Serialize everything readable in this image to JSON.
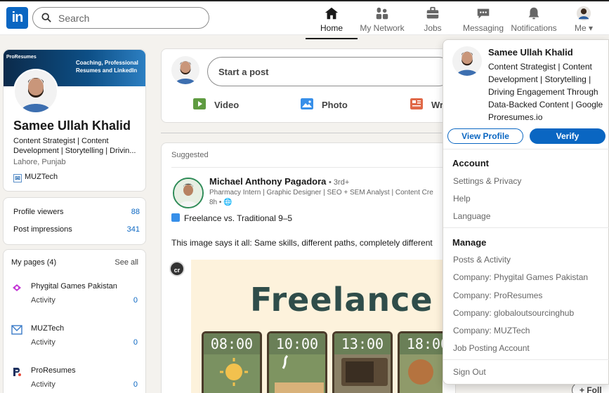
{
  "topbar": {
    "logo": "in",
    "search_placeholder": "Search",
    "nav": [
      {
        "label": "Home",
        "icon": "home-icon",
        "active": true
      },
      {
        "label": "My Network",
        "icon": "network-icon",
        "active": false
      },
      {
        "label": "Jobs",
        "icon": "briefcase-icon",
        "active": false
      },
      {
        "label": "Messaging",
        "icon": "messaging-icon",
        "active": false
      },
      {
        "label": "Notifications",
        "icon": "bell-icon",
        "active": false
      },
      {
        "label": "Me",
        "icon": "avatar-icon",
        "active": false
      }
    ]
  },
  "profile": {
    "banner_small": "ProResumes",
    "banner_text": "Coaching, Professional Resumes and LinkedIn",
    "name": "Samee Ullah Khalid",
    "headline": "Content Strategist | Content Development | Storytelling | Drivin...",
    "location": "Lahore, Punjab",
    "org": "MUZTech"
  },
  "stats": [
    {
      "label": "Profile viewers",
      "value": "88"
    },
    {
      "label": "Post impressions",
      "value": "341"
    }
  ],
  "mypages": {
    "title": "My pages (4)",
    "see_all": "See all",
    "items": [
      {
        "name": "Phygital Games Pakistan",
        "activity": "Activity",
        "count": "0"
      },
      {
        "name": "MUZTech",
        "activity": "Activity",
        "count": "0"
      },
      {
        "name": "ProResumes",
        "activity": "Activity",
        "count": "0"
      }
    ]
  },
  "share": {
    "placeholder": "Start a post",
    "actions": [
      {
        "label": "Video",
        "color": "#5f9b41"
      },
      {
        "label": "Photo",
        "color": "#378fe9"
      },
      {
        "label": "Wr",
        "color": "#e06847"
      }
    ]
  },
  "feed": {
    "header": "Suggested",
    "author": "Michael Anthony Pagadora",
    "degree": "• 3rd+",
    "author_headline": "Pharmacy Intern | Graphic Designer | SEO + SEM Analyst | Content Cre",
    "time": "8h •",
    "title": "Freelance vs. Traditional 9–5",
    "text": "This image says it all: Same skills, different paths, completely different",
    "cr_badge": "cr",
    "image_title": "Freelance",
    "times": [
      "08:00",
      "10:00",
      "13:00",
      "18:00"
    ]
  },
  "dropdown": {
    "name": "Samee Ullah Khalid",
    "headline": "Content Strategist | Content Development | Storytelling | Driving Engagement Through Data-Backed Content | Google Proresumes.io",
    "view_profile": "View Profile",
    "verify": "Verify",
    "account_title": "Account",
    "account_links": [
      "Settings & Privacy",
      "Help",
      "Language"
    ],
    "manage_title": "Manage",
    "manage_links": [
      "Posts & Activity",
      "Company: Phygital Games Pakistan",
      "Company: ProResumes",
      "Company: globaloutsourcinghub",
      "Company: MUZTech",
      "Job Posting Account"
    ],
    "sign_out": "Sign Out"
  },
  "follow_label": "+ Foll",
  "colors": {
    "brand": "#0a66c2",
    "background": "#f4f2ee"
  }
}
